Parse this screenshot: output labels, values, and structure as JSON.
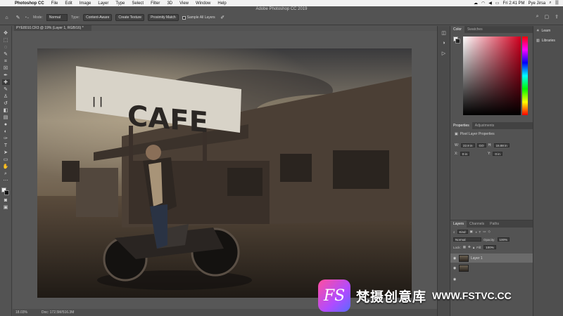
{
  "menubar": {
    "app_name": "Photoshop CC",
    "items": [
      "File",
      "Edit",
      "Image",
      "Layer",
      "Type",
      "Select",
      "Filter",
      "3D",
      "View",
      "Window",
      "Help"
    ],
    "datetime": "Fri 2:41 PM",
    "user": "Pye Jirsa"
  },
  "window": {
    "title": "Adobe Photoshop CC 2019"
  },
  "options": {
    "mode_label": "Mode:",
    "mode_value": "Normal",
    "type_label": "Type:",
    "type_buttons": [
      "Content-Aware",
      "Create Texture",
      "Proximity Match"
    ],
    "sample_all_layers": "Sample All Layers"
  },
  "document": {
    "tab_title": "PYE8010.CR3 @ 19% (Layer 1, RGB/16) *",
    "zoom": "18.03%",
    "doc_size": "Doc: 172.5M/516.3M"
  },
  "canvas": {
    "sign_text": "CAFE"
  },
  "panels": {
    "color_tabs": [
      "Color",
      "Swatches"
    ],
    "properties_tabs": [
      "Properties",
      "Adjustments"
    ],
    "properties_title": "Pixel Layer Properties",
    "prop_w": "22.8 in",
    "prop_go": "GO",
    "prop_h": "15.88 in",
    "prop_x": "0 in",
    "prop_y": "0 in",
    "layers_tabs": [
      "Layers",
      "Channels",
      "Paths"
    ],
    "kind_label": "Kind",
    "blend_mode": "Normal",
    "opacity_label": "Opacity:",
    "opacity_value": "100%",
    "lock_label": "Lock:",
    "fill_label": "Fill:",
    "fill_value": "100%",
    "layers": [
      {
        "name": "Layer 1",
        "selected": true
      },
      {
        "name": "",
        "selected": false
      }
    ]
  },
  "learn_panel": {
    "learn": "Learn",
    "libraries": "Libraries"
  },
  "watermark": {
    "logo": "FS",
    "text": "梵摄创意库",
    "url": "WWW.FSTVC.CC"
  },
  "colors": {
    "ui_dark": "#535353",
    "accent_red": "#d1001f"
  }
}
